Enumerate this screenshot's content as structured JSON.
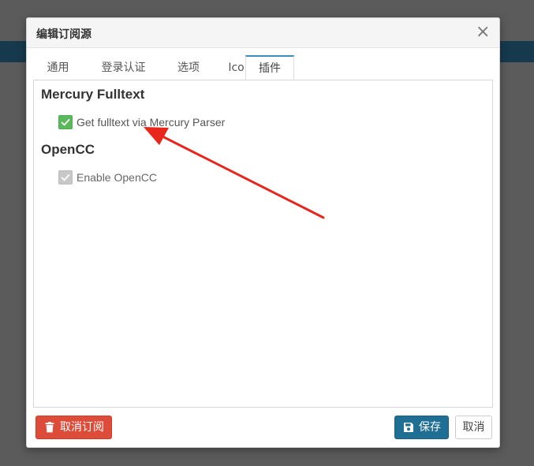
{
  "dialog": {
    "title": "编辑订阅源",
    "close_glyph": "×"
  },
  "tabs": [
    {
      "label": "通用",
      "active": false
    },
    {
      "label": "登录认证",
      "active": false
    },
    {
      "label": "选项",
      "active": false
    },
    {
      "label": "Icon",
      "active": false
    },
    {
      "label": "插件",
      "active": true
    }
  ],
  "plugins": {
    "mercury": {
      "title": "Mercury Fulltext",
      "option_label": "Get fulltext via Mercury Parser",
      "checked": true
    },
    "opencc": {
      "title": "OpenCC",
      "option_label": "Enable OpenCC",
      "checked": true,
      "disabled": true
    }
  },
  "footer": {
    "unsubscribe_label": "取消订阅",
    "save_label": "保存",
    "cancel_label": "取消"
  },
  "colors": {
    "accent": "#3c8dbc",
    "danger": "#dd4b39",
    "primary": "#1f6f94",
    "checkbox_on": "#5cb85c",
    "annotation_arrow": "#e8261c"
  },
  "icons": {
    "close": "close-icon",
    "check": "check-icon",
    "trash": "trash-icon",
    "save": "floppy-disk-icon"
  }
}
